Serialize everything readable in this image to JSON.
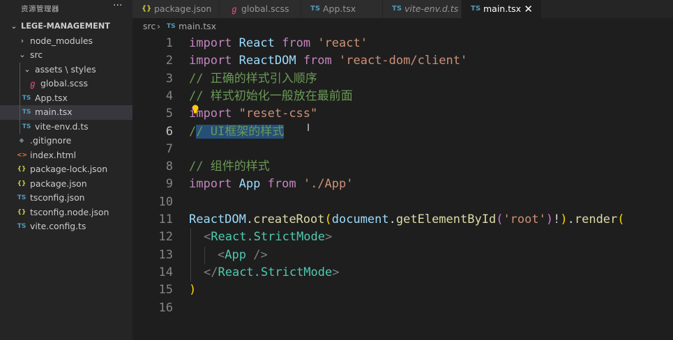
{
  "explorer": {
    "title": "资源管理器",
    "more_icon": "···",
    "root": "LEGE-MANAGEMENT",
    "items": [
      {
        "label": "node_modules",
        "icon": "",
        "chevron": "›"
      },
      {
        "label": "src",
        "icon": "",
        "chevron": "⌄"
      },
      {
        "label": "assets \\ styles",
        "icon": "",
        "chevron": "⌄"
      },
      {
        "label": "global.scss",
        "icon": "sass-icon"
      },
      {
        "label": "App.tsx",
        "icon": "TS"
      },
      {
        "label": "main.tsx",
        "icon": "TS"
      },
      {
        "label": "vite-env.d.ts",
        "icon": "TS"
      },
      {
        "label": ".gitignore",
        "icon": "◆"
      },
      {
        "label": "index.html",
        "icon": "<>"
      },
      {
        "label": "package-lock.json",
        "icon": "{}"
      },
      {
        "label": "package.json",
        "icon": "{}"
      },
      {
        "label": "tsconfig.json",
        "icon": "TS"
      },
      {
        "label": "tsconfig.node.json",
        "icon": "{}"
      },
      {
        "label": "vite.config.ts",
        "icon": "TS"
      }
    ]
  },
  "tabs": [
    {
      "label": "package.json",
      "icon": "{}"
    },
    {
      "label": "global.scss",
      "icon": "sass-icon"
    },
    {
      "label": "App.tsx",
      "icon": "TS"
    },
    {
      "label": "vite-env.d.ts",
      "icon": "TS"
    },
    {
      "label": "main.tsx",
      "icon": "TS",
      "close": "✕"
    }
  ],
  "breadcrumb": {
    "folder": "src",
    "sep": "›",
    "icon": "TS",
    "file": "main.tsx"
  },
  "line_numbers": [
    "1",
    "2",
    "3",
    "4",
    "5",
    "6",
    "7",
    "8",
    "9",
    "10",
    "11",
    "12",
    "13",
    "14",
    "15",
    "16"
  ],
  "code": {
    "l1": {
      "kw": "import",
      "id": "React",
      "kw2": "from",
      "str": "'react'"
    },
    "l2": {
      "kw": "import",
      "id": "ReactDOM",
      "kw2": "from",
      "str": "'react-dom/client'"
    },
    "l3": "// 正确的样式引入顺序",
    "l4": "// 样式初始化一般放在最前面",
    "l5": {
      "kw": "import",
      "str": "\"reset-css\""
    },
    "l6": {
      "a": "/",
      "b": "/ UI框架的样式"
    },
    "l8": "// 组件的样式",
    "l9": {
      "kw": "import",
      "id": "App",
      "kw2": "from",
      "str": "'./App'"
    },
    "l11": {
      "a": "ReactDOM",
      "b": ".",
      "c": "createRoot",
      "d": "(",
      "e": "document",
      "f": ".",
      "g": "getElementById",
      "h": "(",
      "i": "'root'",
      "j": ")",
      "k": "!",
      "l": ")",
      "m": ".",
      "n": "render",
      "o": "("
    },
    "l12": {
      "a": "<",
      "b": "React.StrictMode",
      "c": ">"
    },
    "l13": {
      "a": "<",
      "b": "App",
      "c": " />"
    },
    "l14": {
      "a": "</",
      "b": "React.StrictMode",
      "c": ">"
    },
    "l15": ")"
  },
  "colors": {
    "accent_ts": "#519aba",
    "sass": "#f55385",
    "json": "#cbcb41",
    "git": "#41535b",
    "html": "#e37933",
    "selection": "#264f78"
  }
}
